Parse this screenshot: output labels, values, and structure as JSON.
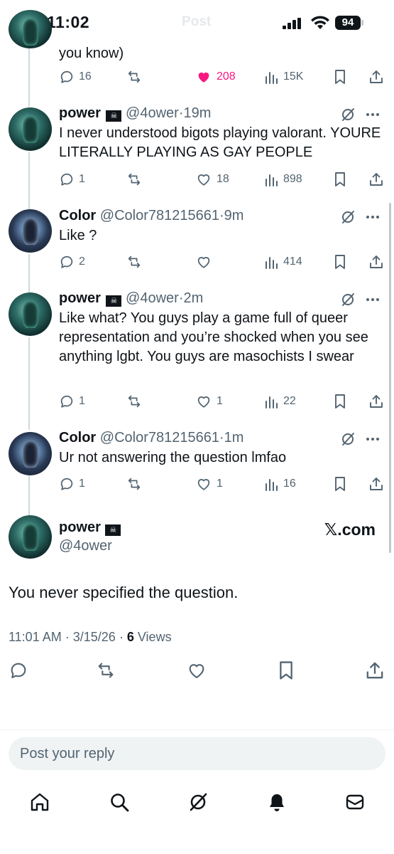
{
  "status_bar": {
    "time": "11:02",
    "battery": "94",
    "ghost_title": "Post"
  },
  "top_fragment": {
    "text": "you know)",
    "actions": {
      "replies": "16",
      "reposts": "",
      "likes": "208",
      "views": "15K"
    }
  },
  "replies": [
    {
      "name": "power",
      "handle": "@4ower",
      "time": "19m",
      "text": "I never understood bigots playing valorant. YOURE LITERALLY PLAYING AS GAY PEOPLE",
      "actions": {
        "replies": "1",
        "reposts": "",
        "likes": "18",
        "views": "898"
      }
    },
    {
      "name": "Color",
      "handle": "@Color781215661",
      "time": "9m",
      "text": "Like ?",
      "actions": {
        "replies": "2",
        "reposts": "",
        "likes": "",
        "views": "414"
      }
    },
    {
      "name": "power",
      "handle": "@4ower",
      "time": "2m",
      "text": "Like what? You guys play a game full of queer representation and you’re shocked when you see anything lgbt. You guys are masochists I swear",
      "actions": {
        "replies": "1",
        "reposts": "",
        "likes": "1",
        "views": "22"
      }
    },
    {
      "name": "Color",
      "handle": "@Color781215661",
      "time": "1m",
      "text": "Ur not answering the question lmfao",
      "actions": {
        "replies": "1",
        "reposts": "",
        "likes": "1",
        "views": "16"
      }
    }
  ],
  "main_post": {
    "name": "power",
    "handle": "@4ower",
    "brand": "𝕏.com",
    "text": "You never specified the question.",
    "time": "11:01 AM",
    "date": "3/15/26",
    "views_count": "6",
    "views_label": "Views"
  },
  "reply_box": {
    "placeholder": "Post your reply"
  },
  "sep": "·",
  "flag_glyph": "☠",
  "colors": {
    "like_active": "#f91880",
    "text_primary": "#0f1419",
    "text_secondary": "#536471"
  },
  "icons": [
    "reply-icon",
    "repost-icon",
    "like-icon",
    "views-icon",
    "bookmark-icon",
    "share-icon",
    "grok-icon",
    "more-icon",
    "home-icon",
    "search-icon",
    "notifications-icon",
    "messages-icon"
  ]
}
